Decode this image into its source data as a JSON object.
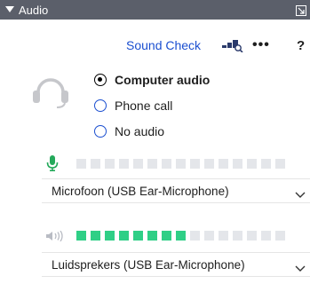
{
  "panel": {
    "title": "Audio"
  },
  "toolbar": {
    "sound_check": "Sound Check",
    "more": "•••",
    "help": "?"
  },
  "audio_options": [
    {
      "label": "Computer audio",
      "selected": true
    },
    {
      "label": "Phone call",
      "selected": false
    },
    {
      "label": "No audio",
      "selected": false
    }
  ],
  "microphone": {
    "device": "Microfoon (USB Ear-Microphone)",
    "level_segments_on": 0,
    "segments_total": 15
  },
  "speaker": {
    "device": "Luidsprekers (USB Ear-Microphone)",
    "level_segments_on": 8,
    "segments_total": 15
  },
  "colors": {
    "titlebar": "#5b5f6a",
    "link": "#1b4fd0",
    "meter_on": "#2fcf86",
    "meter_off": "#e4e6ea",
    "mic_icon": "#25a95b"
  }
}
